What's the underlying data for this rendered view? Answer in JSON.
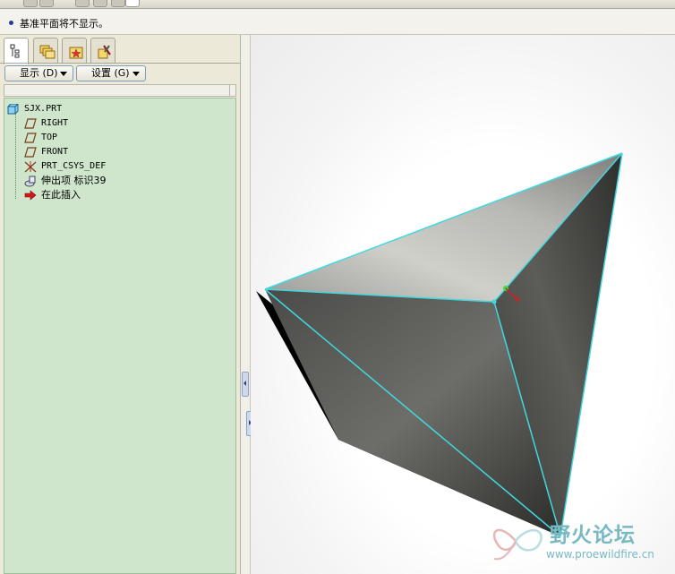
{
  "message": {
    "text": "基准平面将不显示。"
  },
  "navigator": {
    "tabs": [
      {
        "name": "model-tree-tab",
        "icon": "model-tree-icon",
        "active": true
      },
      {
        "name": "folder-browser-tab",
        "icon": "folder-browser-icon",
        "active": false
      },
      {
        "name": "favorites-tab",
        "icon": "favorites-icon",
        "active": false
      },
      {
        "name": "connections-tab",
        "icon": "connections-icon",
        "active": false
      }
    ],
    "show_menu": "显示 (D)",
    "settings_menu": "设置 (G)"
  },
  "tree": {
    "root": "SJX.PRT",
    "items": [
      {
        "label": "RIGHT",
        "icon": "datum-plane-icon"
      },
      {
        "label": "TOP",
        "icon": "datum-plane-icon"
      },
      {
        "label": "FRONT",
        "icon": "datum-plane-icon"
      },
      {
        "label": "PRT_CSYS_DEF",
        "icon": "coordinate-system-icon"
      },
      {
        "label": "伸出项 标识39",
        "icon": "protrusion-icon"
      },
      {
        "label": "在此插入",
        "icon": "insert-here-arrow-icon"
      }
    ]
  },
  "watermark": {
    "title": "野火论坛",
    "url": "www.proewildfire.cn"
  },
  "colors": {
    "tree_background": "#cfe6cd",
    "edge_highlight": "#40d8e0",
    "watermark": "#79b9c3"
  }
}
